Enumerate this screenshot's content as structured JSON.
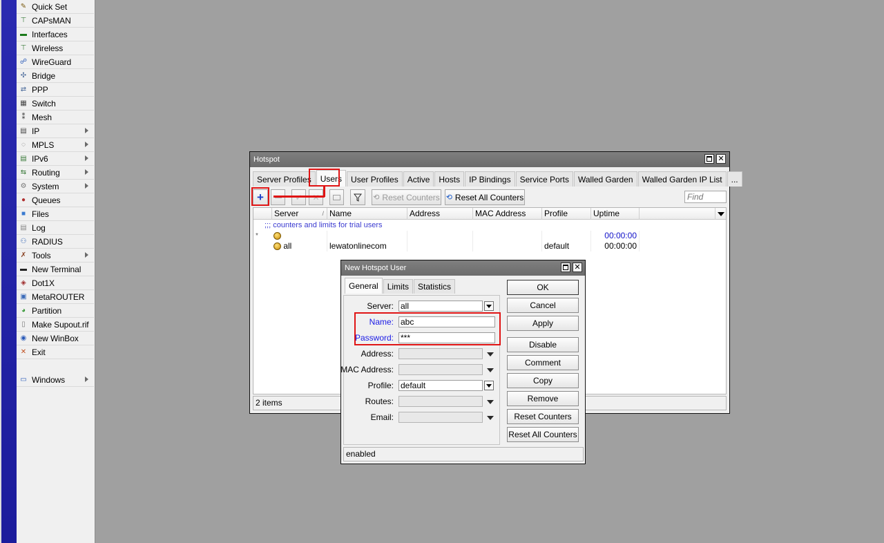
{
  "sidebar": {
    "items": [
      {
        "label": "Quick Set",
        "icon": "wand-icon",
        "submenu": false
      },
      {
        "label": "CAPsMAN",
        "icon": "antenna-icon",
        "submenu": false
      },
      {
        "label": "Interfaces",
        "icon": "interfaces-icon",
        "submenu": false
      },
      {
        "label": "Wireless",
        "icon": "wireless-icon",
        "submenu": false
      },
      {
        "label": "WireGuard",
        "icon": "wireguard-icon",
        "submenu": false
      },
      {
        "label": "Bridge",
        "icon": "bridge-icon",
        "submenu": false
      },
      {
        "label": "PPP",
        "icon": "ppp-icon",
        "submenu": false
      },
      {
        "label": "Switch",
        "icon": "switch-icon",
        "submenu": false
      },
      {
        "label": "Mesh",
        "icon": "mesh-icon",
        "submenu": false
      },
      {
        "label": "IP",
        "icon": "ip-icon",
        "submenu": true
      },
      {
        "label": "MPLS",
        "icon": "mpls-icon",
        "submenu": true
      },
      {
        "label": "IPv6",
        "icon": "ipv6-icon",
        "submenu": true
      },
      {
        "label": "Routing",
        "icon": "routing-icon",
        "submenu": true
      },
      {
        "label": "System",
        "icon": "gear-icon",
        "submenu": true
      },
      {
        "label": "Queues",
        "icon": "queues-icon",
        "submenu": false
      },
      {
        "label": "Files",
        "icon": "folder-icon",
        "submenu": false
      },
      {
        "label": "Log",
        "icon": "log-icon",
        "submenu": false
      },
      {
        "label": "RADIUS",
        "icon": "radius-icon",
        "submenu": false
      },
      {
        "label": "Tools",
        "icon": "tools-icon",
        "submenu": true
      },
      {
        "label": "New Terminal",
        "icon": "terminal-icon",
        "submenu": false
      },
      {
        "label": "Dot1X",
        "icon": "dot1x-icon",
        "submenu": false
      },
      {
        "label": "MetaROUTER",
        "icon": "metarouter-icon",
        "submenu": false
      },
      {
        "label": "Partition",
        "icon": "pie-icon",
        "submenu": false
      },
      {
        "label": "Make Supout.rif",
        "icon": "document-icon",
        "submenu": false
      },
      {
        "label": "New WinBox",
        "icon": "winbox-icon",
        "submenu": false
      },
      {
        "label": "Exit",
        "icon": "exit-icon",
        "submenu": false
      }
    ],
    "windows_label": "Windows"
  },
  "hotspot": {
    "title": "Hotspot",
    "tabs": [
      "Server Profiles",
      "Users",
      "User Profiles",
      "Active",
      "Hosts",
      "IP Bindings",
      "Service Ports",
      "Walled Garden",
      "Walled Garden IP List",
      "..."
    ],
    "active_tab": "Users",
    "toolbar": {
      "reset_counters": "Reset Counters",
      "reset_all_counters": "Reset All Counters",
      "find_placeholder": "Find"
    },
    "columns": [
      "Server",
      "Name",
      "Address",
      "MAC Address",
      "Profile",
      "Uptime"
    ],
    "comment": ";;; counters and limits for trial users",
    "rows": [
      {
        "flag": "*",
        "server": "",
        "name": "",
        "address": "",
        "mac": "",
        "profile": "",
        "uptime": "00:00:00"
      },
      {
        "flag": "",
        "server": "all",
        "name": "lewatonlinecom",
        "address": "",
        "mac": "",
        "profile": "default",
        "uptime": "00:00:00"
      }
    ],
    "status": "2 items"
  },
  "dialog": {
    "title": "New Hotspot User",
    "tabs": [
      "General",
      "Limits",
      "Statistics"
    ],
    "active_tab": "General",
    "fields": {
      "server": {
        "label": "Server:",
        "value": "all"
      },
      "name": {
        "label": "Name:",
        "value": "abc"
      },
      "password": {
        "label": "Password:",
        "value": "***"
      },
      "address": {
        "label": "Address:",
        "value": ""
      },
      "mac": {
        "label": "MAC Address:",
        "value": ""
      },
      "profile": {
        "label": "Profile:",
        "value": "default"
      },
      "routes": {
        "label": "Routes:",
        "value": ""
      },
      "email": {
        "label": "Email:",
        "value": ""
      }
    },
    "buttons": [
      "OK",
      "Cancel",
      "Apply",
      "Disable",
      "Comment",
      "Copy",
      "Remove",
      "Reset Counters",
      "Reset All Counters"
    ],
    "status": "enabled"
  },
  "colors": {
    "highlight": "#e01414",
    "required_label": "#1a1ae6",
    "uptime_text": "#1010c8",
    "desktop": "#a0a0a0"
  }
}
